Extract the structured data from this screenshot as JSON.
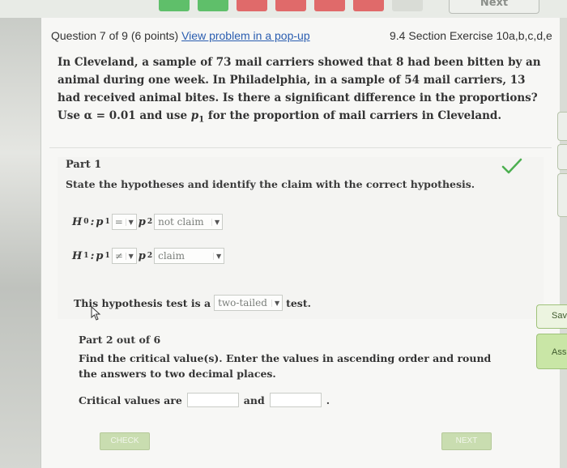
{
  "topnav": {
    "next_label": "Next"
  },
  "header": {
    "question_meta": "Question 7 of 9 (6 points)",
    "popup_link": "View problem in a pop-up",
    "section": "9.4 Section Exercise 10a,b,c,d,e"
  },
  "problem": {
    "text_before_alpha": "In Cleveland, a sample of 73 mail carriers showed that 8 had been bitten by an animal during one week. In Philadelphia, in a sample of 54 mail carriers, 13 had received animal bites. Is there a significant difference in the proportions? Use",
    "alpha_value": "= 0.01 and use",
    "p_symbol": "p",
    "p_sub": "1",
    "text_after": "for the proportion of mail carriers in Cleveland."
  },
  "part1": {
    "title": "Part 1",
    "instruction": "State the hypotheses and identify the claim with the correct hypothesis.",
    "h0": {
      "label": "H",
      "label_sub": "0",
      "p1": "p",
      "p1_sub": "1",
      "operator": "=",
      "p2": "p",
      "p2_sub": "2",
      "claim": "not claim"
    },
    "h1": {
      "label": "H",
      "label_sub": "1",
      "p1": "p",
      "p1_sub": "1",
      "operator": "≠",
      "p2": "p",
      "p2_sub": "2",
      "claim": "claim"
    },
    "test_prefix": "This hypothesis test is a",
    "test_type": "two-tailed",
    "test_suffix": "test.",
    "status": "correct"
  },
  "part2": {
    "title": "Part 2 out of 6",
    "instruction": "Find the critical value(s). Enter the values in ascending order and round the answers to two decimal places.",
    "crit_label": "Critical values are",
    "and_label": "and",
    "value1": "",
    "value2": "",
    "end_mark": "."
  },
  "buttons": {
    "check": "CHECK",
    "next": "NEXT"
  },
  "sidebar": {
    "save_label": "Sav",
    "assign_label": "Ass"
  },
  "colors": {
    "accent_green": "#5fbf6a",
    "link_blue": "#2a5db0",
    "check_green": "#4caf50"
  }
}
